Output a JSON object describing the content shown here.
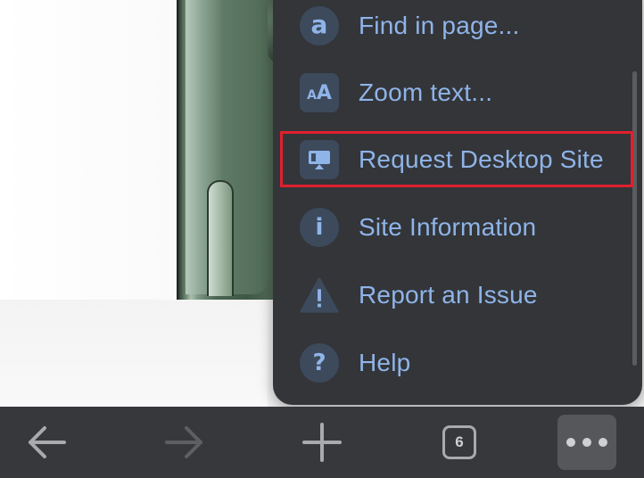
{
  "menu": {
    "items": [
      {
        "label": "Find in page...",
        "icon": "find-in-page-icon",
        "glyph": "a"
      },
      {
        "label": "Zoom text...",
        "icon": "zoom-text-icon",
        "glyph": "AA"
      },
      {
        "label": "Request Desktop Site",
        "icon": "desktop-monitor-icon",
        "glyph": ""
      },
      {
        "label": "Site Information",
        "icon": "info-icon",
        "glyph": "i"
      },
      {
        "label": "Report an Issue",
        "icon": "warning-icon",
        "glyph": "!"
      },
      {
        "label": "Help",
        "icon": "help-icon",
        "glyph": "?"
      }
    ],
    "highlighted_item": "Request Desktop Site"
  },
  "toolbar": {
    "back_icon": "back-arrow-icon",
    "forward_icon": "forward-arrow-icon",
    "new_tab_icon": "plus-icon",
    "tab_count": "6",
    "more_icon": "more-dots-icon"
  },
  "colors": {
    "menu_bg": "#333539",
    "accent_text": "#8fb4e8",
    "highlight": "#e0202e",
    "toolbar_bg": "#36383c"
  }
}
